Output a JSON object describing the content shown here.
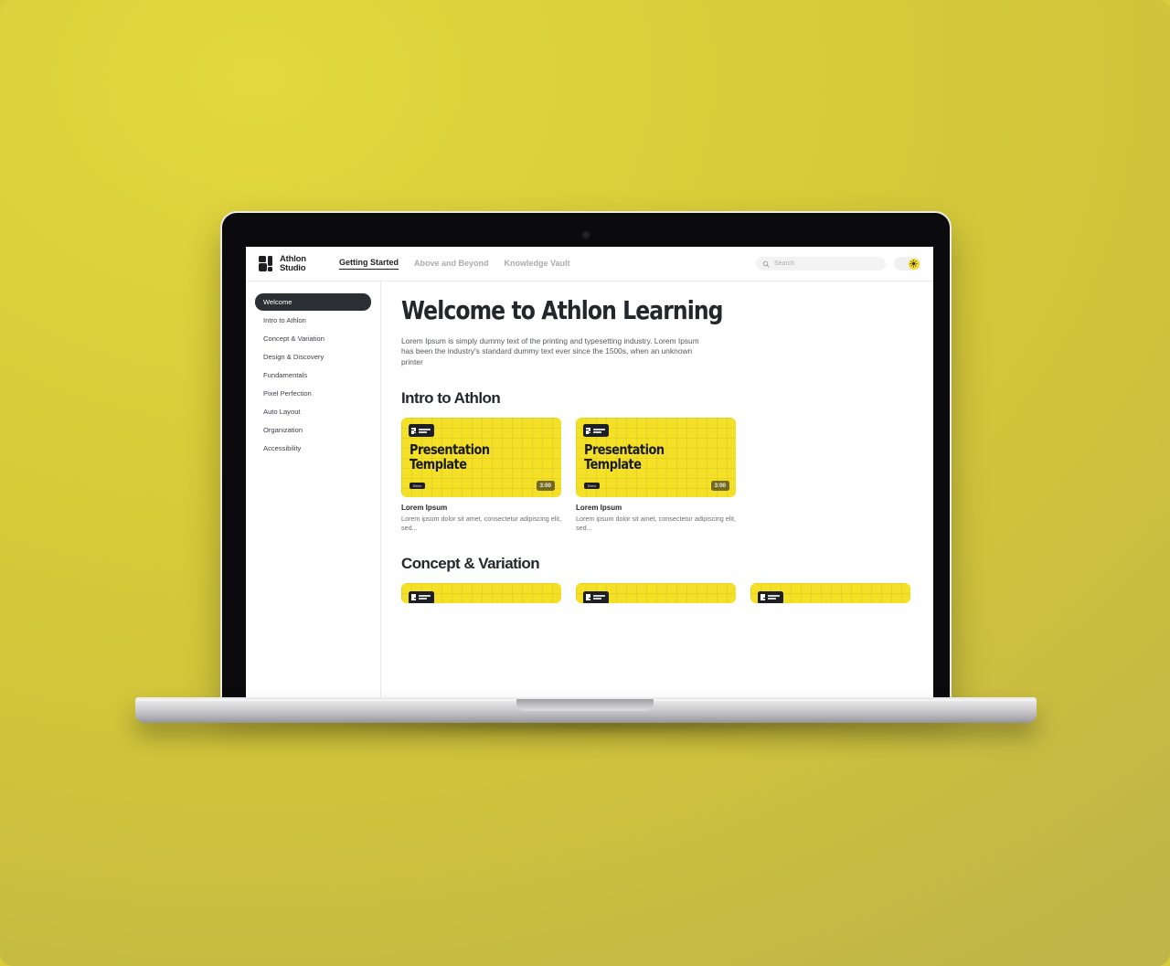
{
  "background": {
    "color_top": "#e2d83f",
    "color_bottom": "#bfb548"
  },
  "device": {
    "name": "laptop-mockup",
    "screen_bg": "#ffffff"
  },
  "app": {
    "brand": {
      "line1": "Athlon",
      "line2": "Studio",
      "mark": "athlon-logo-icon"
    },
    "nav": [
      {
        "label": "Getting Started",
        "active": true
      },
      {
        "label": "Above and Beyond",
        "active": false
      },
      {
        "label": "Knowledge Vault",
        "active": false
      }
    ],
    "search": {
      "placeholder": "Search",
      "value": "",
      "icon": "search-icon"
    },
    "theme_toggle": {
      "state": "light",
      "icon": "sun-icon",
      "knob_color": "#f2dc27"
    },
    "sidebar": {
      "items": [
        {
          "label": "Welcome",
          "active": true
        },
        {
          "label": "Intro to Athlon",
          "active": false
        },
        {
          "label": "Concept & Variation",
          "active": false
        },
        {
          "label": "Design & Discovery",
          "active": false
        },
        {
          "label": "Fundamentals",
          "active": false
        },
        {
          "label": "Pixel Perfection",
          "active": false
        },
        {
          "label": "Auto Layout",
          "active": false
        },
        {
          "label": "Organization",
          "active": false
        },
        {
          "label": "Accessibility",
          "active": false
        }
      ]
    },
    "main": {
      "title": "Welcome to Athlon Learning",
      "lede": "Lorem Ipsum is simply dummy text of the printing and typesetting industry. Lorem Ipsum has been the industry's standard dummy text ever since the 1500s, when an unknown printer",
      "sections": [
        {
          "heading": "Intro to Athlon",
          "cards": [
            {
              "thumb_title": "Presentation Template",
              "thumb_pill": "Demo",
              "duration": "3:00",
              "badge_brand": "Athlon Studio",
              "title": "Lorem Ipsum",
              "desc": "Lorem ipsum dolor sit amet, consectetur adipiscing elit, sed..."
            },
            {
              "thumb_title": "Presentation Template",
              "thumb_pill": "Demo",
              "duration": "3:00",
              "badge_brand": "Athlon Studio",
              "title": "Lorem Ipsum",
              "desc": "Lorem ipsum dolor sit amet, consectetur adipiscing elit, sed..."
            }
          ]
        },
        {
          "heading": "Concept & Variation",
          "cards": [
            {
              "badge_brand": "Athlon Studio"
            },
            {
              "badge_brand": "Athlon Studio"
            },
            {
              "badge_brand": "Athlon Studio"
            }
          ]
        }
      ]
    }
  }
}
